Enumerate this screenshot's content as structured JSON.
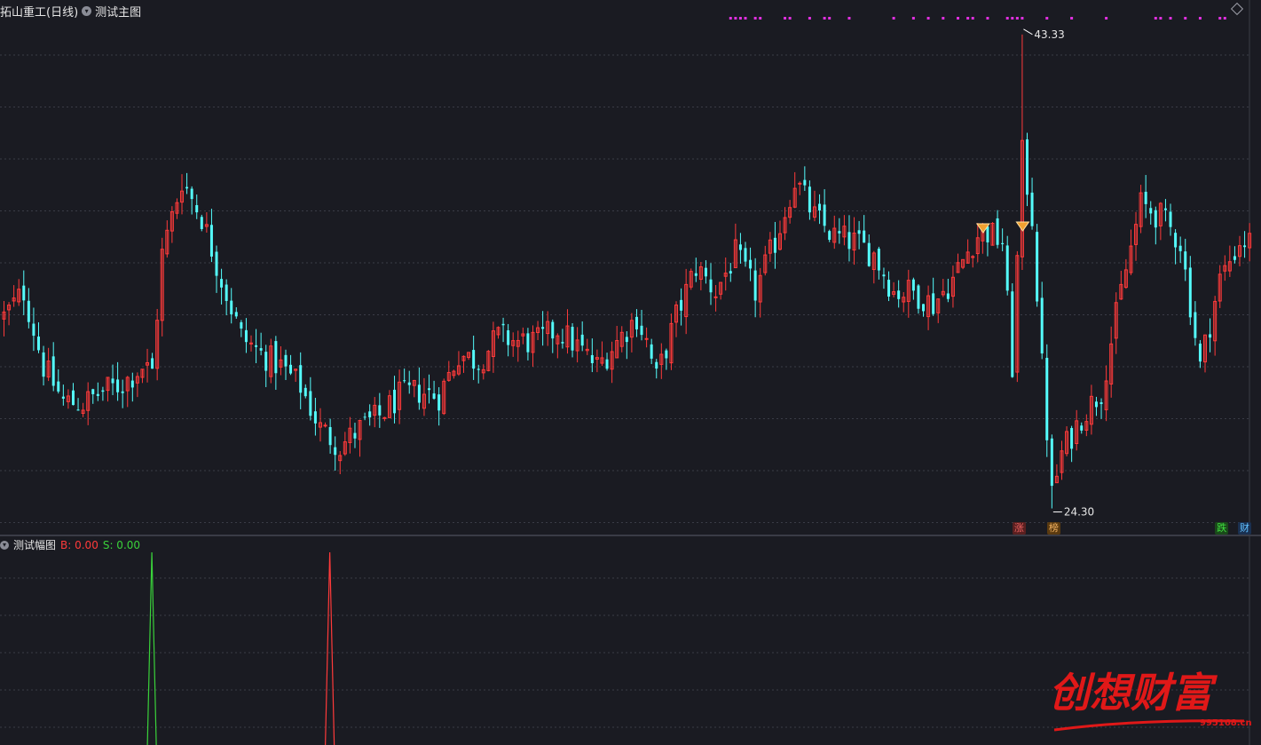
{
  "header": {
    "stock_name": "拓山重工(日线)",
    "main_indicator": "测试主图"
  },
  "sub_header": {
    "indicator": "测试幅图",
    "b_label": "B: 0.00",
    "s_label": "S: 0.00"
  },
  "colors": {
    "up": "#ff3a3a",
    "down": "#54fcfc",
    "background": "#1a1b22",
    "grid": "#3a3c46",
    "marker": "#e030e0",
    "b_signal": "#ff3a3a",
    "s_signal": "#3ad23a"
  },
  "badges": [
    {
      "text": "涨",
      "color": "#e86060",
      "bg": "#5a2020",
      "index": 205
    },
    {
      "text": "榜",
      "color": "#f0b060",
      "bg": "#5a3a10",
      "index": 212
    },
    {
      "text": "跌",
      "color": "#40e040",
      "bg": "#1a4a1a",
      "index": 246
    },
    {
      "text": "财",
      "color": "#60c0ff",
      "bg": "#1a3050",
      "index": 251
    }
  ],
  "watermark": {
    "brand": "创想财富",
    "site": "995168.cn"
  },
  "chart_data": {
    "type": "candlestick",
    "ylim": [
      23.5,
      44.5
    ],
    "high_label": "43.33",
    "low_label": "24.30",
    "gem_markers_index": [
      198,
      206
    ],
    "pivot_points": [
      [
        0,
        32.0
      ],
      [
        4,
        33.0
      ],
      [
        8,
        30.0
      ],
      [
        12,
        28.6
      ],
      [
        16,
        28.5
      ],
      [
        20,
        29.0
      ],
      [
        24,
        29.3
      ],
      [
        28,
        30.0
      ],
      [
        30,
        29.8
      ],
      [
        32,
        34.5
      ],
      [
        36,
        37.5
      ],
      [
        40,
        36.0
      ],
      [
        44,
        33.5
      ],
      [
        48,
        31.2
      ],
      [
        52,
        30.5
      ],
      [
        56,
        30.0
      ],
      [
        60,
        29.2
      ],
      [
        64,
        27.5
      ],
      [
        68,
        26.8
      ],
      [
        72,
        27.5
      ],
      [
        76,
        28.0
      ],
      [
        80,
        28.8
      ],
      [
        84,
        29.0
      ],
      [
        88,
        28.8
      ],
      [
        92,
        30.5
      ],
      [
        96,
        30.2
      ],
      [
        100,
        31.2
      ],
      [
        104,
        31.0
      ],
      [
        108,
        31.0
      ],
      [
        112,
        31.5
      ],
      [
        116,
        30.8
      ],
      [
        120,
        30.0
      ],
      [
        124,
        31.0
      ],
      [
        128,
        32.0
      ],
      [
        130,
        31.0
      ],
      [
        132,
        29.5
      ],
      [
        136,
        32.0
      ],
      [
        140,
        34.0
      ],
      [
        144,
        33.0
      ],
      [
        148,
        34.5
      ],
      [
        152,
        33.0
      ],
      [
        156,
        35.0
      ],
      [
        160,
        37.5
      ],
      [
        164,
        36.0
      ],
      [
        168,
        35.2
      ],
      [
        172,
        35.0
      ],
      [
        176,
        34.5
      ],
      [
        180,
        33.0
      ],
      [
        184,
        33.0
      ],
      [
        188,
        32.5
      ],
      [
        192,
        33.5
      ],
      [
        196,
        35.0
      ],
      [
        198,
        35.5
      ],
      [
        202,
        35.0
      ],
      [
        204,
        30.0
      ],
      [
        206,
        38.5
      ],
      [
        208,
        36.0
      ],
      [
        210,
        30.0
      ],
      [
        212,
        24.8
      ],
      [
        214,
        26.5
      ],
      [
        218,
        28.0
      ],
      [
        222,
        29.0
      ],
      [
        226,
        33.0
      ],
      [
        230,
        36.5
      ],
      [
        234,
        36.0
      ],
      [
        238,
        35.0
      ],
      [
        242,
        30.0
      ],
      [
        246,
        33.5
      ],
      [
        250,
        35.0
      ]
    ],
    "sub_spikes": [
      {
        "index": 30,
        "value": 1.0,
        "color": "#3ad23a"
      },
      {
        "index": 66,
        "value": 1.0,
        "color": "#ff3a3a"
      }
    ],
    "top_markers_index": [
      147,
      148,
      149,
      150,
      152,
      153,
      158,
      159,
      163,
      166,
      167,
      171,
      180,
      184,
      187,
      190,
      193,
      195,
      196,
      199,
      203,
      204,
      205,
      206,
      211,
      216,
      223,
      233,
      234,
      236,
      239,
      242,
      246,
      247
    ]
  }
}
